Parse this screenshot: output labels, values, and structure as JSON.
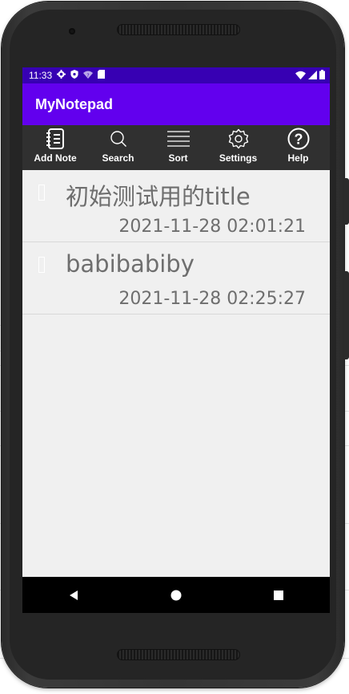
{
  "status_bar": {
    "time": "11:33",
    "left_icons": [
      "gear-icon",
      "shield-icon",
      "wifi-question-icon",
      "sd-card-icon"
    ],
    "right_icons": [
      "wifi-icon",
      "signal-icon",
      "battery-icon"
    ]
  },
  "app_bar": {
    "title": "MyNotepad"
  },
  "toolbar": {
    "items": [
      {
        "label": "Add Note",
        "icon": "notebook-icon"
      },
      {
        "label": "Search",
        "icon": "search-icon"
      },
      {
        "label": "Sort",
        "icon": "sort-lines-icon"
      },
      {
        "label": "Settings",
        "icon": "gear-icon"
      },
      {
        "label": "Help",
        "icon": "help-icon"
      }
    ]
  },
  "notes": [
    {
      "title": "初始测试用的title",
      "date": "2021-11-28 02:01:21"
    },
    {
      "title": "babibabiby",
      "date": "2021-11-28 02:25:27"
    }
  ],
  "nav_bar": {
    "buttons": [
      "back-icon",
      "home-icon",
      "recents-icon"
    ]
  },
  "colors": {
    "status_bar": "#3700b3",
    "app_bar": "#6200ee",
    "toolbar": "#303030",
    "list_background": "#f0f0f0",
    "note_text": "#6e6e6e"
  }
}
